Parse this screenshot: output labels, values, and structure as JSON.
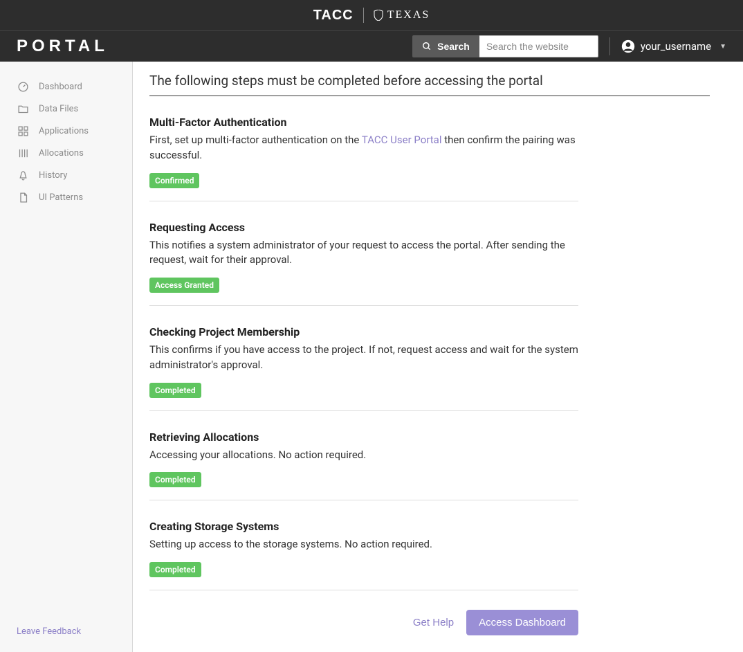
{
  "brand": {
    "tacc": "TACC",
    "texas": "TEXAS"
  },
  "portal": {
    "logo": "PORTAL"
  },
  "search": {
    "button": "Search",
    "placeholder": "Search the website"
  },
  "user": {
    "name": "your_username"
  },
  "sidebar": {
    "items": [
      {
        "label": "Dashboard"
      },
      {
        "label": "Data Files"
      },
      {
        "label": "Applications"
      },
      {
        "label": "Allocations"
      },
      {
        "label": "History"
      },
      {
        "label": "UI Patterns"
      }
    ],
    "feedback": "Leave Feedback"
  },
  "page": {
    "title": "The following steps must be completed before accessing the portal"
  },
  "steps": [
    {
      "title": "Multi-Factor Authentication",
      "desc_pre": "First, set up multi-factor authentication on the ",
      "link": "TACC User Portal",
      "desc_post": " then confirm the pairing was successful.",
      "badge": "Confirmed"
    },
    {
      "title": "Requesting Access",
      "desc": "This notifies a system administrator of your request to access the portal. After sending the request, wait for their approval.",
      "badge": "Access Granted"
    },
    {
      "title": "Checking Project Membership",
      "desc": "This confirms if you have access to the project. If not, request access and wait for the system administrator's approval.",
      "badge": "Completed"
    },
    {
      "title": "Retrieving Allocations",
      "desc": "Accessing your allocations. No action required.",
      "badge": "Completed"
    },
    {
      "title": "Creating Storage Systems",
      "desc": "Setting up access to the storage systems. No action required.",
      "badge": "Completed"
    }
  ],
  "actions": {
    "help": "Get Help",
    "dashboard": "Access Dashboard"
  }
}
